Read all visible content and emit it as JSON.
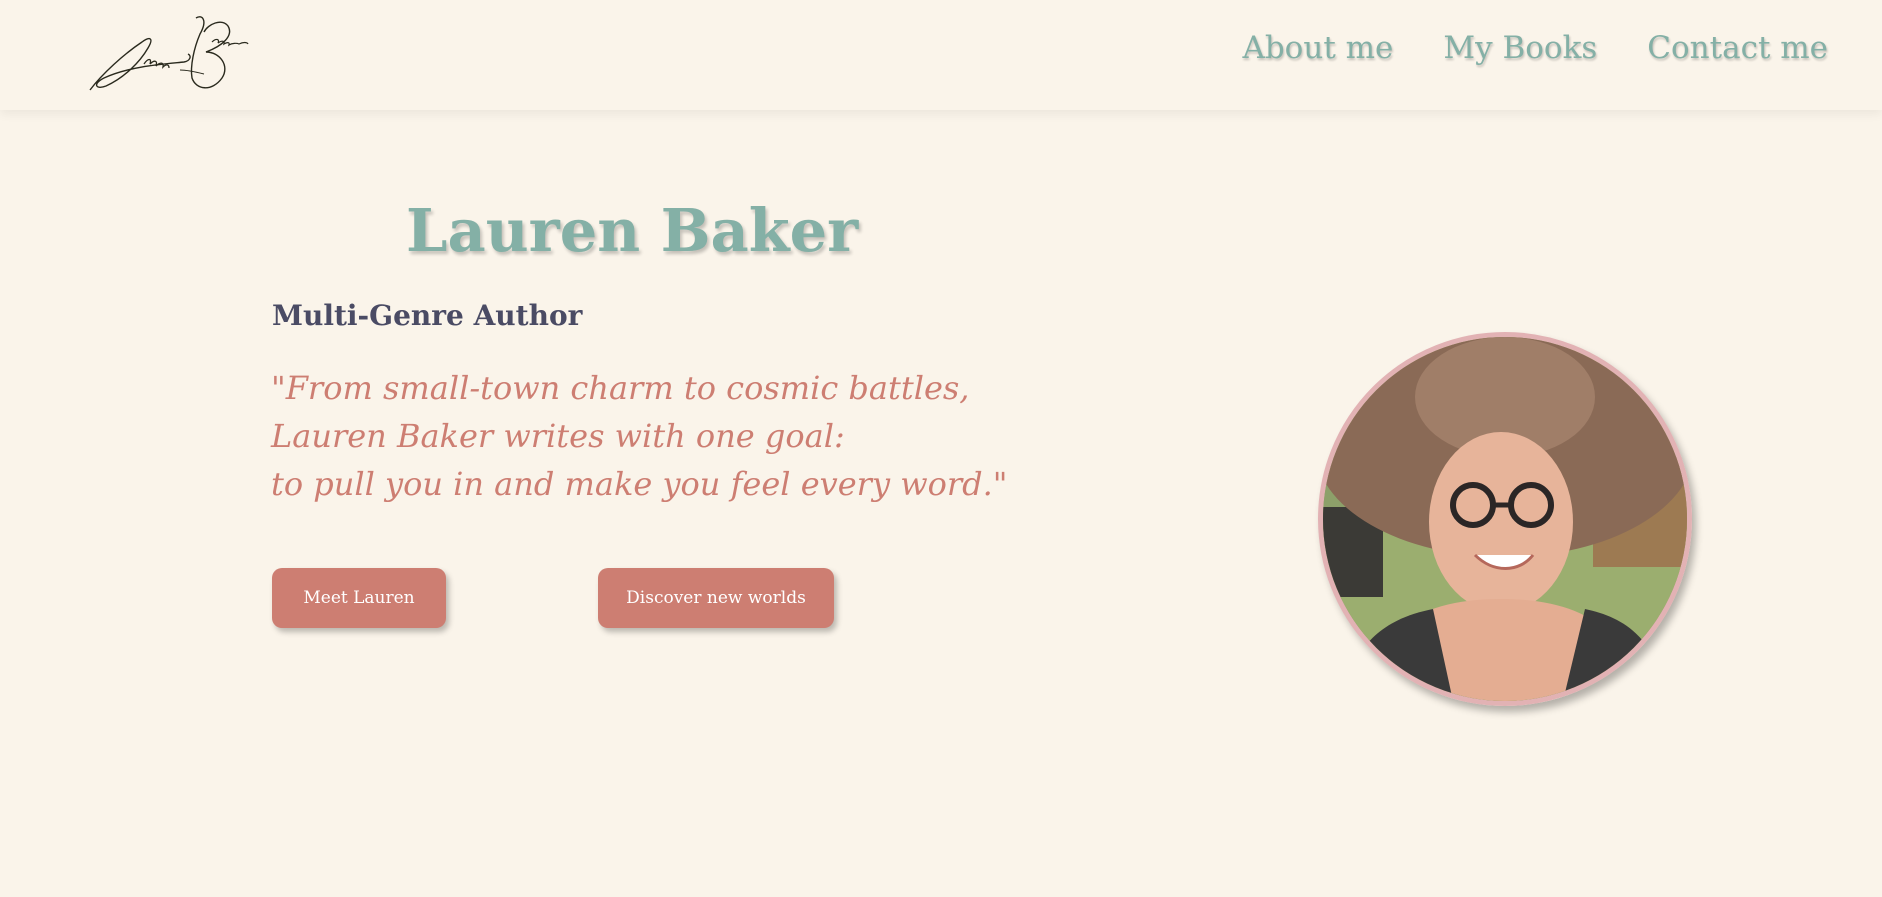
{
  "header": {
    "logo_text": "Lauren Baker",
    "nav": [
      {
        "label": "About me"
      },
      {
        "label": "My Books"
      },
      {
        "label": "Contact me"
      }
    ]
  },
  "hero": {
    "name": "Lauren Baker",
    "subtitle": "Multi-Genre Author",
    "quote_lines": [
      "\"From small-town charm to cosmic battles,",
      "Lauren Baker writes with one goal:",
      "to pull you in and make you feel every word.\""
    ],
    "buttons": {
      "meet": "Meet Lauren",
      "discover": "Discover new worlds"
    }
  },
  "colors": {
    "background": "#faf4ea",
    "accent_teal": "#84b0a6",
    "accent_coral": "#cd7e72",
    "heading_dark": "#4a4b64",
    "portrait_border": "#e2b2b4"
  },
  "icons": {
    "logo": "signature-logo",
    "portrait": "author-photo"
  }
}
